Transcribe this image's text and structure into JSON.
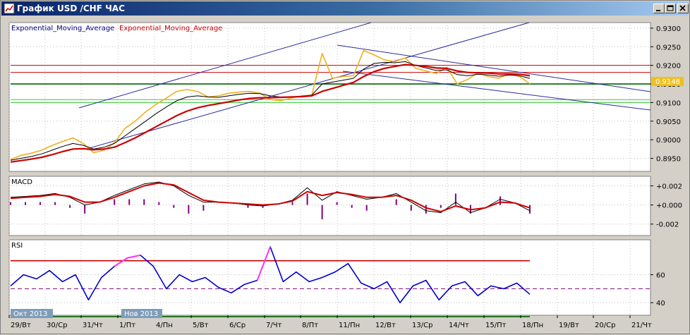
{
  "window": {
    "title": "График USD /CHF ЧАС",
    "buttons": [
      "minimize",
      "maximize",
      "close"
    ]
  },
  "chart_data": {
    "type": "line",
    "symbol": "USD/CHF",
    "timeframe": "ЧАС",
    "legend": [
      "Exponential_Moving_Average",
      "Exponential_Moving_Average"
    ],
    "legend_colors": [
      "#000080",
      "#cc0000"
    ],
    "x_labels": [
      "29/Вт",
      "30/Ср",
      "31/Чт",
      "1/Пт",
      "4/Пн",
      "5/Вт",
      "6/Ср",
      "7/Чт",
      "8/Пт",
      "11/Пн",
      "12/Вт",
      "13/Ср",
      "14/Чт",
      "15/Пт",
      "18/Пн",
      "19/Вт",
      "20/Ср",
      "21/Чт"
    ],
    "month_labels": [
      "Окт 2013",
      "Нов 2013"
    ],
    "price_panel": {
      "ylim": [
        0.8915,
        0.9315
      ],
      "ticks": [
        "0.9300",
        "0.9250",
        "0.9200",
        "0.9150",
        "0.9100",
        "0.9050",
        "0.9000",
        "0.8950"
      ],
      "current_price": "0.9148",
      "price": [
        0.8947,
        0.8958,
        0.8964,
        0.8972,
        0.8985,
        0.8995,
        0.9005,
        0.899,
        0.8965,
        0.8972,
        0.8992,
        0.903,
        0.905,
        0.9075,
        0.9095,
        0.9112,
        0.913,
        0.9135,
        0.913,
        0.9115,
        0.9118,
        0.9125,
        0.9128,
        0.913,
        0.9125,
        0.9108,
        0.9105,
        0.9112,
        0.9118,
        0.912,
        0.9232,
        0.9165,
        0.917,
        0.9172,
        0.924,
        0.9228,
        0.9215,
        0.921,
        0.922,
        0.9192,
        0.9185,
        0.9178,
        0.9195,
        0.915,
        0.9162,
        0.918,
        0.917,
        0.9165,
        0.9178,
        0.917,
        0.915
      ],
      "ema_fast": [
        0.8945,
        0.895,
        0.8955,
        0.8962,
        0.8972,
        0.8982,
        0.899,
        0.8985,
        0.8975,
        0.898,
        0.899,
        0.901,
        0.903,
        0.905,
        0.907,
        0.9088,
        0.9105,
        0.9115,
        0.9118,
        0.9115,
        0.9114,
        0.9118,
        0.9122,
        0.9125,
        0.9124,
        0.9118,
        0.9115,
        0.9115,
        0.9117,
        0.912,
        0.915,
        0.9155,
        0.916,
        0.9165,
        0.919,
        0.9205,
        0.9208,
        0.9207,
        0.921,
        0.92,
        0.9193,
        0.9186,
        0.9188,
        0.9175,
        0.9172,
        0.9176,
        0.9174,
        0.9171,
        0.9174,
        0.9172,
        0.9165
      ],
      "ema_slow": [
        0.894,
        0.8944,
        0.8948,
        0.8953,
        0.896,
        0.8968,
        0.8975,
        0.8976,
        0.8973,
        0.8975,
        0.898,
        0.8992,
        0.9005,
        0.902,
        0.9035,
        0.905,
        0.9065,
        0.9077,
        0.9086,
        0.9092,
        0.9097,
        0.9102,
        0.9107,
        0.9111,
        0.9113,
        0.9113,
        0.9114,
        0.9115,
        0.9116,
        0.9118,
        0.913,
        0.9138,
        0.9146,
        0.9154,
        0.917,
        0.9183,
        0.9192,
        0.9197,
        0.9202,
        0.92,
        0.9197,
        0.9193,
        0.9192,
        0.9185,
        0.9181,
        0.918,
        0.9179,
        0.9177,
        0.9177,
        0.9176,
        0.9172
      ],
      "horizontal_levels": [
        {
          "value": 0.92,
          "color": "#cc0000"
        },
        {
          "value": 0.9181,
          "color": "#cc0000"
        },
        {
          "value": 0.915,
          "color": "#006400"
        },
        {
          "value": 0.9108,
          "color": "#33cc33"
        },
        {
          "value": 0.91,
          "color": "#33cc33"
        }
      ]
    },
    "macd_panel": {
      "label": "MACD",
      "ylim": [
        -0.0032,
        0.003
      ],
      "ticks": [
        "+0.002",
        "+0.000",
        "-0.002"
      ],
      "macd": [
        0.0008,
        0.0009,
        0.001,
        0.0012,
        0.0008,
        0.0,
        0.0003,
        0.001,
        0.0016,
        0.0022,
        0.0024,
        0.002,
        0.001,
        0.0003,
        0.0003,
        0.0002,
        0.0,
        -0.0001,
        0.0001,
        0.0005,
        0.0018,
        0.0005,
        0.0014,
        0.001,
        0.0006,
        0.0008,
        0.0012,
        0.0003,
        -0.0006,
        -0.0008,
        0.0003,
        -0.0008,
        -0.0003,
        0.0006,
        0.0002,
        -0.0006
      ],
      "signal": [
        0.0007,
        0.0008,
        0.0009,
        0.0011,
        0.0009,
        0.0003,
        0.0003,
        0.0008,
        0.0014,
        0.002,
        0.0023,
        0.0021,
        0.0013,
        0.0005,
        0.0003,
        0.0002,
        0.0001,
        0.0,
        0.0001,
        0.0004,
        0.0014,
        0.001,
        0.0013,
        0.0011,
        0.0008,
        0.0008,
        0.001,
        0.0005,
        -0.0003,
        -0.0007,
        -0.0001,
        -0.0005,
        -0.0003,
        0.0003,
        0.0002,
        -0.0003
      ]
    },
    "rsi_panel": {
      "label": "RSI",
      "ylim": [
        31,
        85
      ],
      "ticks": [
        "60",
        "40"
      ],
      "levels": [
        70,
        50,
        30
      ],
      "rsi": [
        52,
        60,
        57,
        63,
        55,
        60,
        42,
        58,
        66,
        72,
        74,
        66,
        50,
        60,
        55,
        58,
        51,
        47,
        53,
        56,
        80,
        55,
        62,
        55,
        58,
        62,
        68,
        54,
        50,
        55,
        40,
        52,
        56,
        42,
        52,
        55,
        45,
        52,
        50,
        54,
        46
      ]
    }
  }
}
